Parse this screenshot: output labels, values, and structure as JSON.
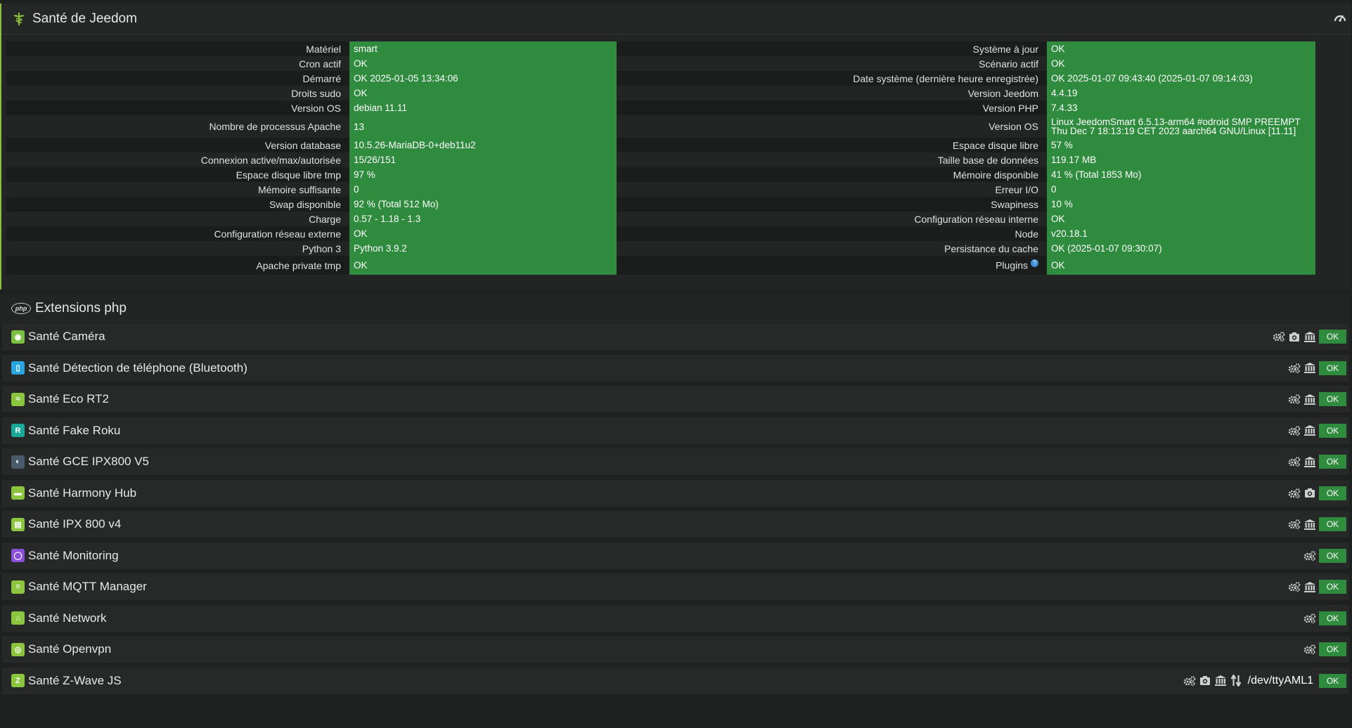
{
  "health": {
    "title": "Santé de Jeedom",
    "rows": [
      {
        "l1": "Matériel",
        "v1": "smart",
        "l2": "Système à jour",
        "v2": "OK"
      },
      {
        "l1": "Cron actif",
        "v1": "OK",
        "l2": "Scénario actif",
        "v2": "OK"
      },
      {
        "l1": "Démarré",
        "v1": "OK 2025-01-05 13:34:06",
        "l2": "Date système (dernière heure enregistrée)",
        "v2": "OK 2025-01-07 09:43:40 (2025-01-07 09:14:03)"
      },
      {
        "l1": "Droits sudo",
        "v1": "OK",
        "l2": "Version Jeedom",
        "v2": "4.4.19"
      },
      {
        "l1": "Version OS",
        "v1": "debian 11.11",
        "l2": "Version PHP",
        "v2": "7.4.33"
      },
      {
        "l1": "Nombre de processus Apache",
        "v1": "13",
        "l2": "Version OS",
        "v2": "Linux JeedomSmart 6.5.13-arm64 #odroid SMP PREEMPT Thu Dec 7 18:13:19 CET 2023 aarch64 GNU/Linux [11.11]"
      },
      {
        "l1": "Version database",
        "v1": "10.5.26-MariaDB-0+deb11u2",
        "l2": "Espace disque libre",
        "v2": "57 %"
      },
      {
        "l1": "Connexion active/max/autorisée",
        "v1": "15/26/151",
        "l2": "Taille base de données",
        "v2": "119.17 MB"
      },
      {
        "l1": "Espace disque libre tmp",
        "v1": "97 %",
        "l2": "Mémoire disponible",
        "v2": "41 % (Total 1853 Mo)"
      },
      {
        "l1": "Mémoire suffisante",
        "v1": "0",
        "l2": "Erreur I/O",
        "v2": "0"
      },
      {
        "l1": "Swap disponible",
        "v1": "92 % (Total 512 Mo)",
        "l2": "Swapiness",
        "v2": "10 %"
      },
      {
        "l1": "Charge",
        "v1": "0.57 - 1.18 - 1.3",
        "l2": "Configuration réseau interne",
        "v2": "OK"
      },
      {
        "l1": "Configuration réseau externe",
        "v1": "OK",
        "l2": "Node",
        "v2": "v20.18.1"
      },
      {
        "l1": "Python 3",
        "v1": "Python 3.9.2",
        "l2": "Persistance du cache",
        "v2": "OK (2025-01-07 09:30:07)"
      },
      {
        "l1": "Apache private tmp",
        "v1": "OK",
        "l2": "Plugins",
        "v2": "OK"
      }
    ],
    "plugins_help": "?"
  },
  "extensions": {
    "title": "Extensions php",
    "badge": "php"
  },
  "plugins": [
    {
      "name": "Santé Caméra",
      "color": "#7bc043",
      "glyph": "◉",
      "tools": [
        "cogs",
        "camera",
        "bank"
      ],
      "port": "",
      "status": "OK"
    },
    {
      "name": "Santé Détection de téléphone (Bluetooth)",
      "color": "#29a6e0",
      "glyph": "▯",
      "tools": [
        "cogs",
        "bank"
      ],
      "port": "",
      "status": "OK"
    },
    {
      "name": "Santé Eco RT2",
      "color": "#8cc63f",
      "glyph": "≈",
      "tools": [
        "cogs",
        "bank"
      ],
      "port": "",
      "status": "OK"
    },
    {
      "name": "Santé Fake Roku",
      "color": "#1aa89a",
      "glyph": "R",
      "tools": [
        "cogs",
        "bank"
      ],
      "port": "",
      "status": "OK"
    },
    {
      "name": "Santé GCE IPX800 V5",
      "color": "#4a5a6a",
      "glyph": "◐",
      "tools": [
        "cogs",
        "bank"
      ],
      "port": "",
      "status": "OK"
    },
    {
      "name": "Santé Harmony Hub",
      "color": "#8cc63f",
      "glyph": "▬",
      "tools": [
        "cogs",
        "camera"
      ],
      "port": "",
      "status": "OK"
    },
    {
      "name": "Santé IPX 800 v4",
      "color": "#8cc63f",
      "glyph": "▤",
      "tools": [
        "cogs",
        "bank"
      ],
      "port": "",
      "status": "OK"
    },
    {
      "name": "Santé Monitoring",
      "color": "#8a4fd8",
      "glyph": "◯",
      "tools": [
        "cogs"
      ],
      "port": "",
      "status": "OK"
    },
    {
      "name": "Santé MQTT Manager",
      "color": "#8cc63f",
      "glyph": "≡",
      "tools": [
        "cogs",
        "bank"
      ],
      "port": "",
      "status": "OK"
    },
    {
      "name": "Santé Network",
      "color": "#8cc63f",
      "glyph": "⌂",
      "tools": [
        "cogs"
      ],
      "port": "",
      "status": "OK"
    },
    {
      "name": "Santé Openvpn",
      "color": "#8cc63f",
      "glyph": "◎",
      "tools": [
        "cogs"
      ],
      "port": "",
      "status": "OK"
    },
    {
      "name": "Santé Z-Wave JS",
      "color": "#8cc63f",
      "glyph": "Z",
      "tools": [
        "cogs",
        "camera",
        "bank",
        "arrows"
      ],
      "port": "/dev/ttyAML1",
      "status": "OK"
    }
  ],
  "colors": {
    "ok_green": "#2f8b3e",
    "accent": "#8cbf3f"
  }
}
